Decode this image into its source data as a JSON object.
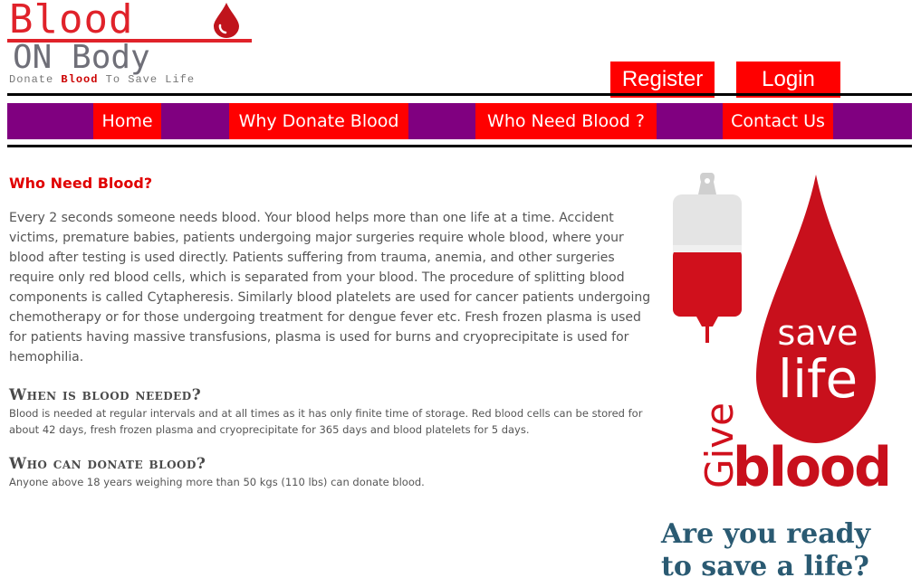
{
  "logo": {
    "word1": "Blood",
    "word2": "ON Body",
    "tagline_pre": "Donate",
    "tagline_mid": "Blood",
    "tagline_post": "To Save Life",
    "icon": "blood-drop-icon"
  },
  "auth": {
    "register_label": "Register",
    "login_label": "Login"
  },
  "nav": {
    "items": [
      {
        "label": "Home"
      },
      {
        "label": "Why Donate Blood"
      },
      {
        "label": "Who Need Blood ?"
      },
      {
        "label": "Contact Us"
      }
    ]
  },
  "main": {
    "title": "Who Need Blood?",
    "intro": "Every 2 seconds someone needs blood. Your blood helps more than one life at a time. Accident victims, premature babies, patients undergoing major surgeries require whole blood, where your blood after testing is used directly. Patients suffering from trauma, anemia, and other surgeries require only red blood cells, which is separated from your blood. The procedure of splitting blood components is called Cytapheresis. Similarly blood platelets are used for cancer patients undergoing chemotherapy or for those undergoing treatment for dengue fever etc. Fresh frozen plasma is used for patients having massive transfusions, plasma is used for burns and cryoprecipitate is used for hemophilia.",
    "sections": [
      {
        "heading": "When is blood needed?",
        "text": "Blood is needed at regular intervals and at all times as it has only finite time of storage. Red blood cells can be stored for about 42 days, fresh frozen plasma and cryoprecipitate for 365 days and blood platelets for 5 days."
      },
      {
        "heading": "Who can donate blood?",
        "text": "Anyone above 18 years weighing more than 50 kgs (110 lbs) can donate blood."
      }
    ]
  },
  "illustration": {
    "give": "Give",
    "blood": "blood",
    "save": "save",
    "life": "life"
  },
  "cta": {
    "line": "Are you ready to save a life?"
  },
  "colors": {
    "accent_red": "#ff0000",
    "nav_purple": "#800080",
    "title_red": "#e00000",
    "cta_blue": "#2a5a72"
  }
}
